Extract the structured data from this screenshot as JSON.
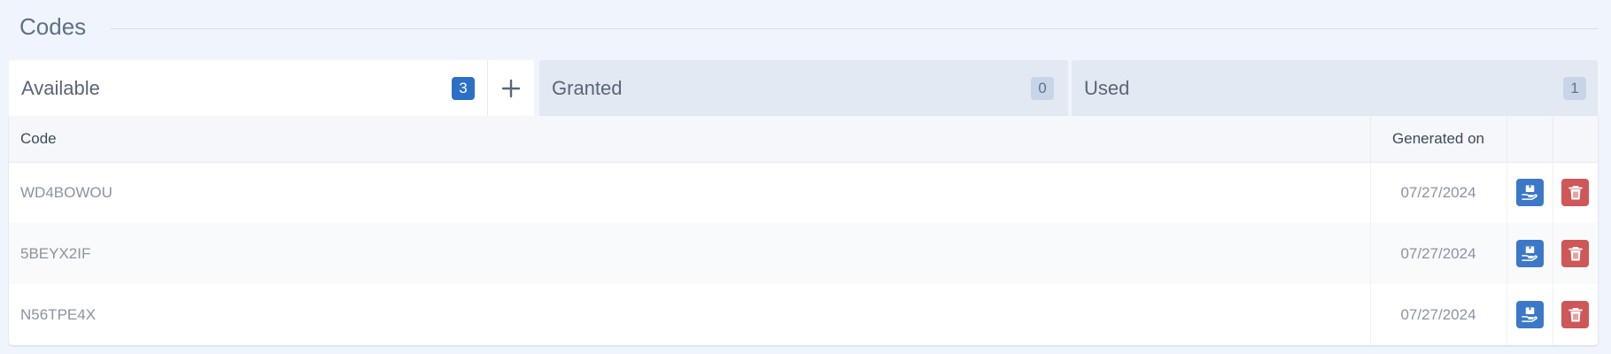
{
  "section": {
    "title": "Codes"
  },
  "tabs": [
    {
      "label": "Available",
      "count": "3",
      "active": true
    },
    {
      "label": "Granted",
      "count": "0",
      "active": false
    },
    {
      "label": "Used",
      "count": "1",
      "active": false
    }
  ],
  "table": {
    "headers": {
      "code": "Code",
      "generated_on": "Generated on"
    },
    "rows": [
      {
        "code": "WD4BOWOU",
        "generated_on": "07/27/2024"
      },
      {
        "code": "5BEYX2IF",
        "generated_on": "07/27/2024"
      },
      {
        "code": "N56TPE4X",
        "generated_on": "07/27/2024"
      }
    ]
  },
  "icons": {
    "add": "plus-icon",
    "grant": "hand-holding-box-icon",
    "delete": "trash-icon"
  },
  "colors": {
    "page_background": "#f0f5fd",
    "active_badge": "#2c6fc9",
    "inactive_tab": "#e3e9f2",
    "grant_button": "#3b78c8",
    "delete_button": "#cf5757"
  }
}
